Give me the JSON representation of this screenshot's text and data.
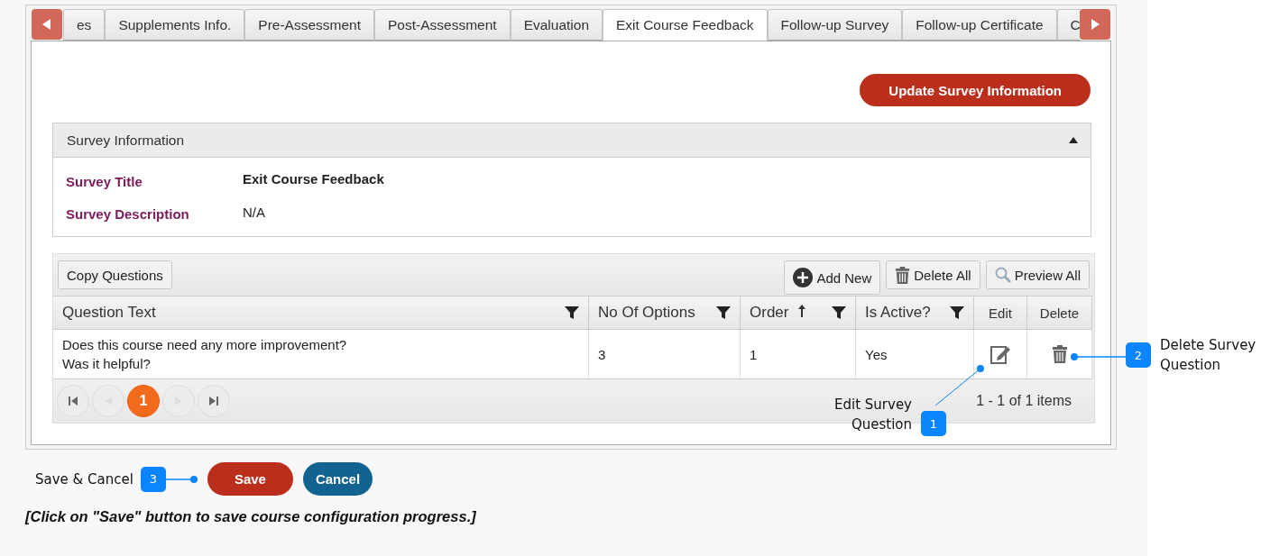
{
  "tabs": [
    {
      "label": "es",
      "selected": false
    },
    {
      "label": "Supplements Info.",
      "selected": false
    },
    {
      "label": "Pre-Assessment",
      "selected": false
    },
    {
      "label": "Post-Assessment",
      "selected": false
    },
    {
      "label": "Evaluation",
      "selected": false
    },
    {
      "label": "Exit Course Feedback",
      "selected": true
    },
    {
      "label": "Follow-up Survey",
      "selected": false
    },
    {
      "label": "Follow-up Certificate",
      "selected": false
    },
    {
      "label": "C",
      "selected": false
    }
  ],
  "update_button": "Update Survey Information",
  "survey_info": {
    "header": "Survey Information",
    "expanded": true,
    "fields": [
      {
        "label": "Survey Title",
        "value": "Exit Course Feedback",
        "emphasis": true
      },
      {
        "label": "Survey Description",
        "value": "N/A",
        "emphasis": false
      }
    ]
  },
  "grid": {
    "copy_button": "Copy Questions",
    "actions": [
      {
        "kind": "add",
        "label": "Add New"
      },
      {
        "kind": "delete",
        "label": "Delete All"
      },
      {
        "kind": "preview",
        "label": "Preview All"
      }
    ],
    "columns": [
      {
        "label": "Question Text",
        "kind": "text",
        "filter": true,
        "sorted": false
      },
      {
        "label": "No Of Options",
        "kind": "text",
        "filter": true,
        "sorted": false
      },
      {
        "label": "Order",
        "kind": "text",
        "filter": true,
        "sorted": true
      },
      {
        "label": "Is Active?",
        "kind": "text",
        "filter": true,
        "sorted": false
      },
      {
        "label": "Edit",
        "kind": "edit",
        "filter": false,
        "sorted": false
      },
      {
        "label": "Delete",
        "kind": "delete",
        "filter": false,
        "sorted": false
      }
    ],
    "rows": [
      {
        "cells": [
          [
            "Does this course need any more improvement?",
            "Was it helpful?"
          ],
          [
            "3"
          ],
          [
            "1"
          ],
          [
            "Yes"
          ]
        ]
      }
    ],
    "pages": [
      {
        "label": "1",
        "selected": true
      }
    ],
    "summary": "1 - 1 of 1 items"
  },
  "callouts": [
    {
      "number": "1",
      "lines": [
        "Edit Survey",
        "Question"
      ]
    },
    {
      "number": "2",
      "lines": [
        "Delete Survey",
        "Question"
      ]
    },
    {
      "number": "3",
      "lines": [
        "Save & Cancel"
      ]
    }
  ],
  "save_button": "Save",
  "cancel_button": "Cancel",
  "note": "[Click on \"Save\" button to save course configuration progress.]"
}
